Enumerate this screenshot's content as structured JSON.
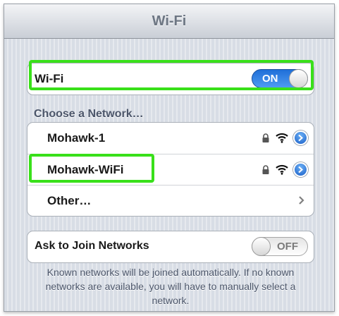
{
  "navbar": {
    "title": "Wi-Fi"
  },
  "wifi": {
    "label": "Wi-Fi",
    "toggle_text": "ON"
  },
  "networks": {
    "header": "Choose a Network…",
    "items": [
      {
        "name": "Mohawk-1"
      },
      {
        "name": "Mohawk-WiFi"
      },
      {
        "name": "Other…"
      }
    ]
  },
  "ask_join": {
    "label": "Ask to Join Networks",
    "toggle_text": "OFF"
  },
  "footer": {
    "text": "Known networks will be joined automatically. If no known networks are available, you will have to manually select a network."
  },
  "colors": {
    "highlight": "#39e01a",
    "accent": "#1f6fd8"
  }
}
